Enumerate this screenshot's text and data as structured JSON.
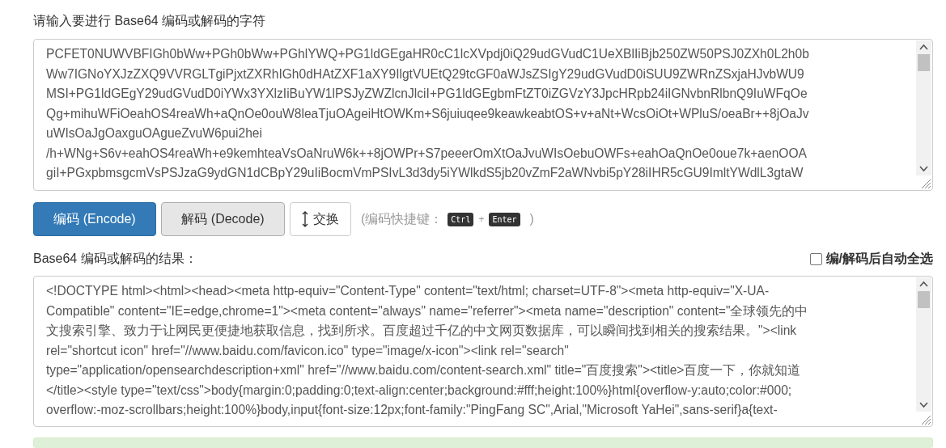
{
  "input_label": "请输入要进行 Base64 编码或解码的字符",
  "input_lines": [
    "PCFET0NUWVBFIGh0bWw+PGh0bWw+PGhlYWQ+PG1ldGEgaHR0cC1lcXVpdj0iQ29udGVudC1UeXBlIiBjb250ZW50PSJ0ZXh0L2h0b",
    "Ww7IGNoYXJzZXQ9VVRGLTgiPjxtZXRhIGh0dHAtZXF1aXY9IlgtVUEtQ29tcGF0aWJsZSIgY29udGVudD0iSUU9ZWRnZSxjaHJvbWU9",
    "MSI+PG1ldGEgY29udGVudD0iYWx3YXlzIiBuYW1lPSJyZWZlcnJlciI+PG1ldGEgbmFtZT0iZGVzY3JpcHRpb24iIGNvbnRlbnQ9IuWFqOe",
    "Qg+mihuWFiOeahOS4reaWh+aQnOe0ouW8leaTjuOAgeiHtOWKm+S6juiuqee9keawkeabtOS+v+aNt+WcsOiOt+WPluS/oeaBr++8jOaJv",
    "uWIsOaJgOaxguOAgueZvuW6pui2hei",
    "/h+WNg+S6v+eahOS4reaWh+e9kemhteaVsOaNruW6k++8jOWPr+S7peeerOmXtOaJvuWIsOebuOWFs+eahOaQnOe0oue7k+aenOOA",
    "giI+PGxpbmsgcmVsPSJzaG9ydGN1dCBpY29uIiBocmVmPSIvL3d3dy5iYWlkdS5jb20vZmF2aWNvbi5pY28iIHR5cGU9ImltYWdlL3gtaW"
  ],
  "buttons": [
    {
      "kind": "primary",
      "label": "编码 (Encode)"
    },
    {
      "kind": "default",
      "label": "解码 (Decode)"
    },
    {
      "kind": "swap",
      "label": "交换"
    }
  ],
  "shortcut": {
    "prefix": "(编码快捷键：",
    "keys": [
      "Ctrl",
      "Enter"
    ],
    "plus": "+",
    "suffix": ")"
  },
  "result_label": "Base64 编码或解码的结果：",
  "auto_select": {
    "label": "编/解码后自动全选",
    "checked": false
  },
  "output_lines": [
    "<!DOCTYPE html><html><head><meta http-equiv=\"Content-Type\" content=\"text/html; charset=UTF-8\"><meta http-equiv=\"X-UA-",
    "Compatible\" content=\"IE=edge,chrome=1\"><meta content=\"always\" name=\"referrer\"><meta name=\"description\" content=\"全球领先的中",
    "文搜索引擎、致力于让网民更便捷地获取信息，找到所求。百度超过千亿的中文网页数据库，可以瞬间找到相关的搜索结果。\"><link",
    "rel=\"shortcut icon\" href=\"//www.baidu.com/favicon.ico\" type=\"image/x-icon\"><link rel=\"search\"",
    "type=\"application/opensearchdescription+xml\" href=\"//www.baidu.com/content-search.xml\" title=\"百度搜索\"><title>百度一下，你就知道",
    "</title><style type=\"text/css\">body{margin:0;padding:0;text-align:center;background:#fff;height:100%}html{overflow-y:auto;color:#000;",
    "overflow:-moz-scrollbars;height:100%}body,input{font-size:12px;font-family:\"PingFang SC\",Arial,\"Microsoft YaHei\",sans-serif}a{text-"
  ]
}
